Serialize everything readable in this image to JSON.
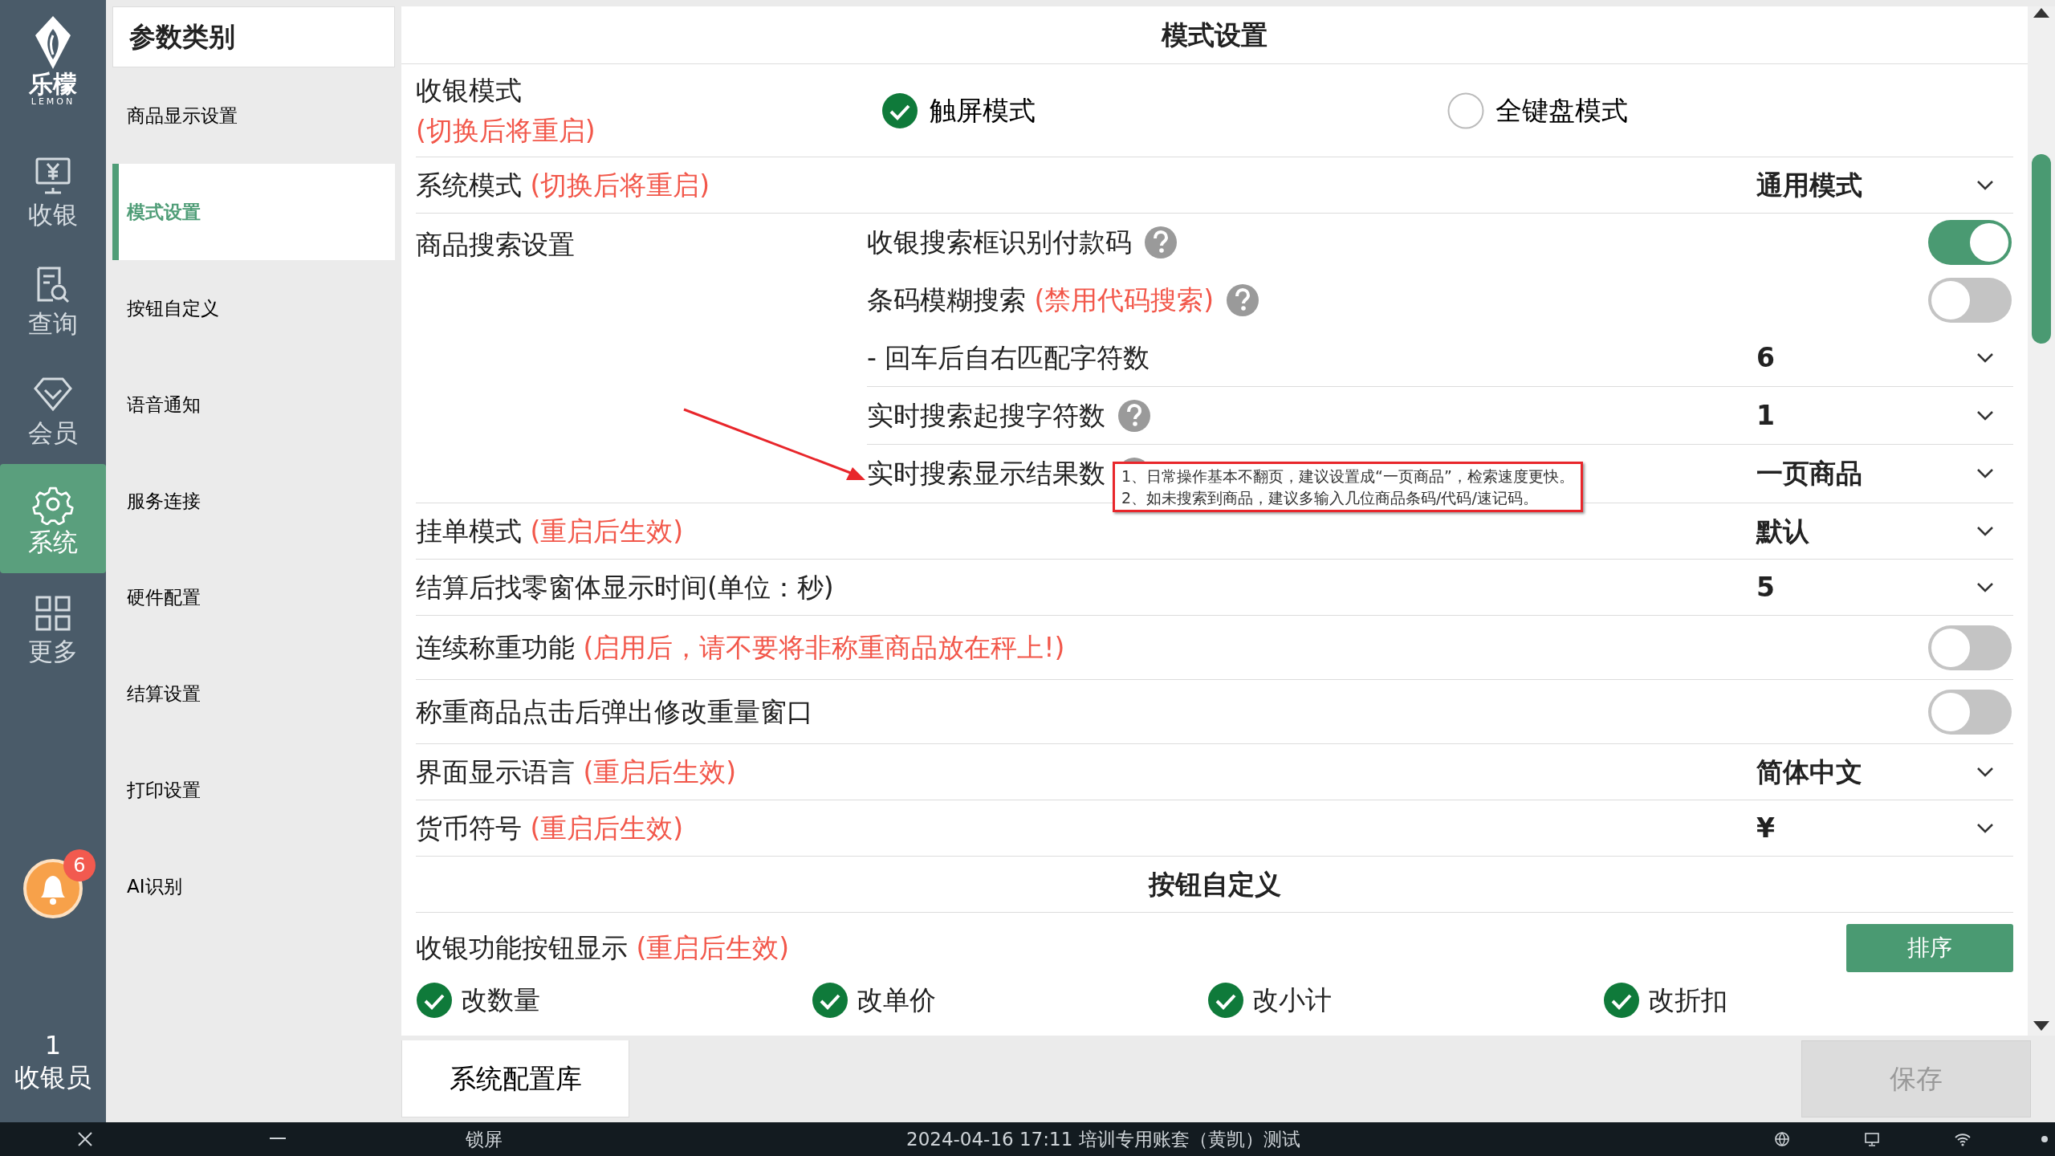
{
  "sidebar": {
    "logo_text": "乐檬",
    "logo_subtext": "LEMON",
    "items": [
      {
        "label": "收银",
        "selected": false
      },
      {
        "label": "查询",
        "selected": false
      },
      {
        "label": "会员",
        "selected": false
      },
      {
        "label": "系统",
        "selected": true
      },
      {
        "label": "更多",
        "selected": false
      }
    ],
    "notification_count": "6",
    "user": {
      "number": "1",
      "role": "收银员"
    }
  },
  "categories": {
    "title": "参数类别",
    "items": [
      {
        "label": "商品显示设置",
        "selected": false
      },
      {
        "label": "模式设置",
        "selected": true
      },
      {
        "label": "按钮自定义",
        "selected": false
      },
      {
        "label": "语音通知",
        "selected": false
      },
      {
        "label": "服务连接",
        "selected": false
      },
      {
        "label": "硬件配置",
        "selected": false
      },
      {
        "label": "结算设置",
        "selected": false
      },
      {
        "label": "打印设置",
        "selected": false
      },
      {
        "label": "AI识别",
        "selected": false
      }
    ]
  },
  "main": {
    "title": "模式设置",
    "rows": [
      {
        "kind": "radio",
        "label": "收银模式",
        "note": "(切换后将重启)",
        "options": [
          {
            "label": "触屏模式",
            "selected": true
          },
          {
            "label": "全键盘模式",
            "selected": false
          }
        ]
      },
      {
        "kind": "select",
        "label": "系统模式",
        "note": "(切换后将重启)",
        "value": "通用模式"
      },
      {
        "kind": "group",
        "label": "商品搜索设置",
        "children": [
          {
            "kind": "toggle",
            "label": "收银搜索框识别付款码",
            "help": true,
            "on": true
          },
          {
            "kind": "toggle",
            "label": "条码模糊搜索",
            "note": "(禁用代码搜索)",
            "help": true,
            "on": false
          },
          {
            "kind": "select",
            "label": "- 回车后自右匹配字符数",
            "value": "6"
          },
          {
            "kind": "select",
            "label": "实时搜索起搜字符数",
            "help": true,
            "value": "1"
          },
          {
            "kind": "select",
            "label": "实时搜索显示结果数",
            "help": true,
            "value": "一页商品"
          }
        ]
      },
      {
        "kind": "select",
        "label": "挂单模式",
        "note": "(重启后生效)",
        "value": "默认"
      },
      {
        "kind": "select",
        "label": "结算后找零窗体显示时间(单位：秒)",
        "value": "5"
      },
      {
        "kind": "toggle",
        "label": "连续称重功能",
        "note": "(启用后，请不要将非称重商品放在秤上!)",
        "on": false
      },
      {
        "kind": "toggle",
        "label": "称重商品点击后弹出修改重量窗口",
        "on": false
      },
      {
        "kind": "select",
        "label": "界面显示语言",
        "note": "(重启后生效)",
        "value": "简体中文"
      },
      {
        "kind": "select",
        "label": "货币符号",
        "note": "(重启后生效)",
        "value": "¥"
      },
      {
        "kind": "section",
        "label": "按钮自定义"
      },
      {
        "kind": "checks",
        "label": "收银功能按钮显示",
        "note": "(重启后生效)",
        "button": "排序",
        "options": [
          {
            "label": "改数量",
            "checked": true
          },
          {
            "label": "改单价",
            "checked": true
          },
          {
            "label": "改小计",
            "checked": true
          },
          {
            "label": "改折扣",
            "checked": true
          }
        ]
      }
    ]
  },
  "tooltip": {
    "lines": [
      "1、日常操作基本不翻页，建议设置成“一页商品”，检索速度更快。",
      "2、如未搜索到商品，建议多输入几位商品条码/代码/速记码。"
    ]
  },
  "footer": {
    "tab": "系统配置库",
    "save": {
      "label": "保存",
      "disabled": true
    }
  },
  "taskbar": {
    "lock": "锁屏",
    "status": "2024-04-16 17:11 培训专用账套（黄凯）测试"
  }
}
